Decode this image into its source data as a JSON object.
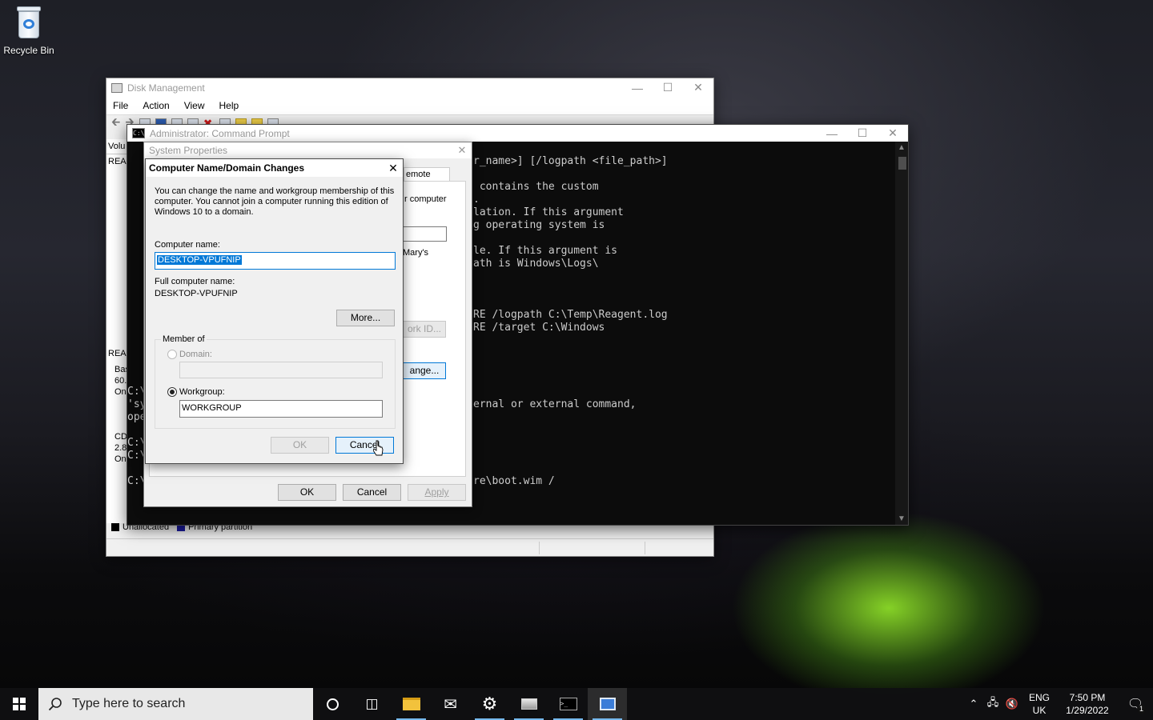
{
  "desktop": {
    "recycle_bin_label": "Recycle Bin"
  },
  "disk_management": {
    "title": "Disk Management",
    "menu": [
      "File",
      "Action",
      "View",
      "Help"
    ],
    "pane_fragments": [
      "Volu",
      "REA",
      "Bas",
      "60.",
      "On",
      "CD",
      "2.8",
      "On",
      "REA"
    ],
    "legend": {
      "unallocated": "Unallocated",
      "primary": "Primary partition"
    },
    "legend_colors": {
      "unallocated": "#000000",
      "primary": "#1a1aa0"
    }
  },
  "cmd": {
    "title": "Administrator: Command Prompt",
    "lines": [
      "r_name>] [/logpath <file_path>]",
      " contains the custom",
      ".",
      "lation. If this argument",
      "g operating system is",
      "le. If this argument is",
      "ath is Windows\\Logs\\",
      "RE /logpath C:\\Temp\\Reagent.log",
      "RE /target C:\\Windows",
      "ernal or external command,",
      "re\\boot.wim /"
    ],
    "left_fragments": [
      "C:\\",
      "'sy",
      "ope",
      "C:\\",
      "C:\\",
      "C:\\"
    ]
  },
  "system_properties": {
    "title": "System Properties",
    "tab_remote": "emote",
    "frag_computer": "r computer",
    "frag_marys": "Mary's",
    "frag_network_id": "ork ID...",
    "frag_change": "ange...",
    "ok": "OK",
    "cancel": "Cancel",
    "apply": "Apply"
  },
  "computer_name_dialog": {
    "title": "Computer Name/Domain Changes",
    "description": "You can change the name and workgroup membership of this computer. You cannot join a computer running this edition of Windows 10 to a domain.",
    "computer_name_label": "Computer name:",
    "computer_name_value": "DESKTOP-VPUFNIP",
    "full_name_label": "Full computer name:",
    "full_name_value": "DESKTOP-VPUFNIP",
    "more_button": "More...",
    "member_of_label": "Member of",
    "domain_label": "Domain:",
    "domain_value": "",
    "workgroup_label": "Workgroup:",
    "workgroup_value": "WORKGROUP",
    "ok": "OK",
    "cancel": "Cancel"
  },
  "taskbar": {
    "search_placeholder": "Type here to search",
    "lang_top": "ENG",
    "lang_bottom": "UK",
    "time": "7:50 PM",
    "date": "1/29/2022",
    "notification_count": "1"
  }
}
